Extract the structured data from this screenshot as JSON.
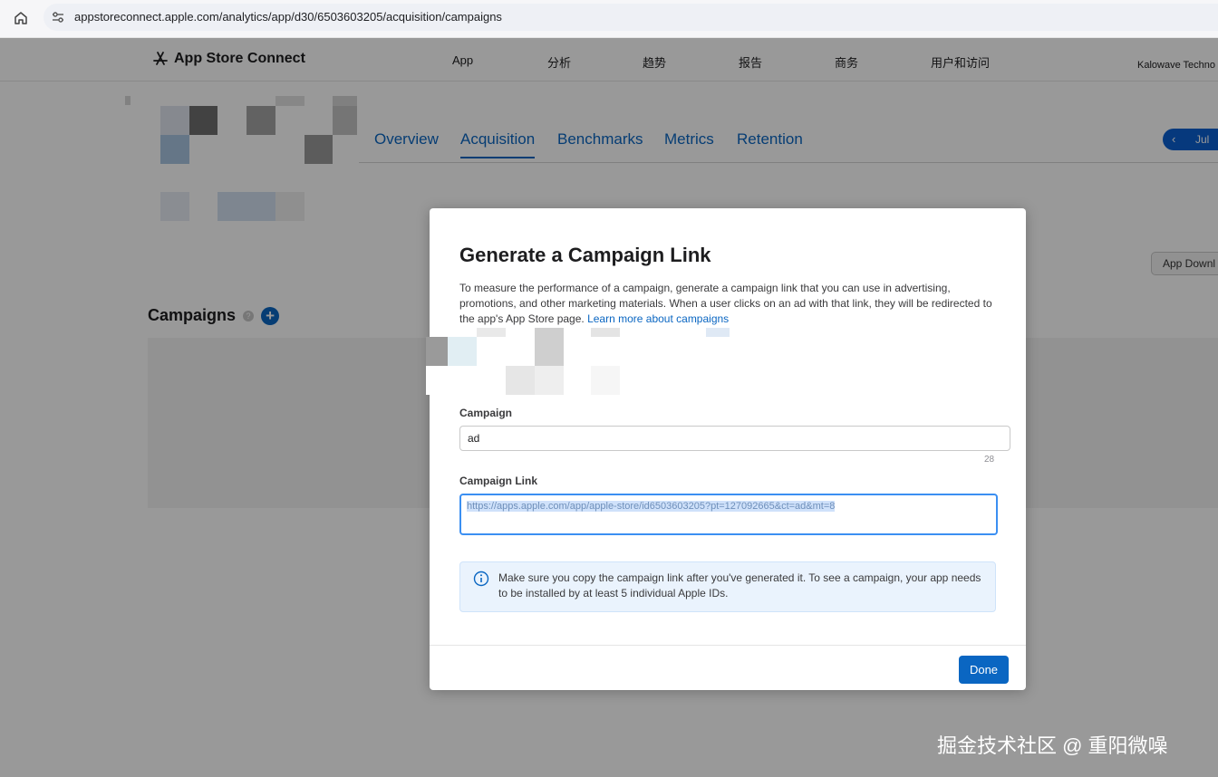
{
  "browser": {
    "url": "appstoreconnect.apple.com/analytics/app/d30/6503603205/acquisition/campaigns"
  },
  "header": {
    "brand": "App Store Connect",
    "nav": [
      "App",
      "分析",
      "趋势",
      "报告",
      "商务",
      "用户和访问"
    ],
    "account": "Kalowave Techno"
  },
  "tabs": [
    "Overview",
    "Acquisition",
    "Benchmarks",
    "Metrics",
    "Retention"
  ],
  "date_button": "Jul",
  "app_downloads_button": "App Downl",
  "campaigns": {
    "title": "Campaigns",
    "help": "?"
  },
  "modal": {
    "title": "Generate a Campaign Link",
    "description": "To measure the performance of a campaign, generate a campaign link that you can use in advertising, promotions, and other marketing materials. When a user clicks on an ad with that link, they will be redirected to the app's App Store page.",
    "learn_more": "Learn more about campaigns",
    "campaign_label": "Campaign",
    "campaign_value": "ad",
    "char_count": "28",
    "link_label": "Campaign Link",
    "link_value": "https://apps.apple.com/app/apple-store/id6503603205?pt=127092665&ct=ad&mt=8",
    "info": "Make sure you copy the campaign link after you've generated it. To see a campaign, your app needs to be installed by at least 5 individual Apple IDs.",
    "done": "Done"
  },
  "watermark": "掘金技术社区 @ 重阳微噪",
  "colors": {
    "accent": "#0a66c2",
    "overlay": "rgba(0,0,0,0.40)",
    "info_bg": "#eaf3fd"
  }
}
